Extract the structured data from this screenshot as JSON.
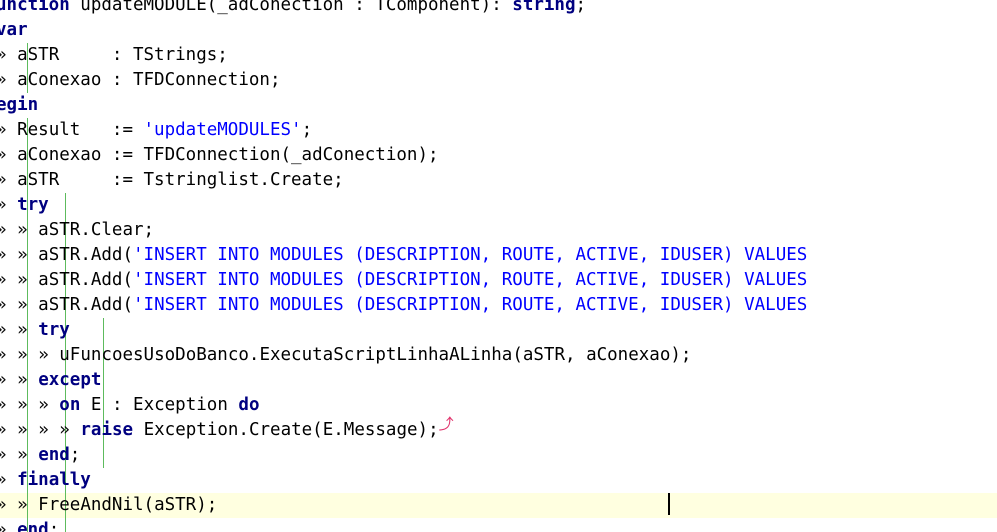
{
  "editor": {
    "lines": [
      {
        "tokens": [
          {
            "k": "k",
            "t": "unction"
          },
          {
            "k": "n",
            "t": " updateMODULE(_adConection : TComponent): "
          },
          {
            "k": "k",
            "t": "string"
          },
          {
            "k": "n",
            "t": ";"
          }
        ]
      },
      {
        "tokens": [
          {
            "k": "k",
            "t": "var"
          }
        ]
      },
      {
        "guides": [
          0
        ],
        "tokens": [
          {
            "k": "g",
            "t": "»"
          },
          {
            "k": "n",
            "t": " aSTR     : TStrings;"
          }
        ]
      },
      {
        "guides": [
          0
        ],
        "tokens": [
          {
            "k": "g",
            "t": "»"
          },
          {
            "k": "n",
            "t": " aConexao : TFDConnection;"
          }
        ]
      },
      {
        "tokens": [
          {
            "k": "k",
            "t": "egin"
          }
        ]
      },
      {
        "guides": [
          0
        ],
        "tokens": [
          {
            "k": "g",
            "t": "»"
          },
          {
            "k": "n",
            "t": " Result   := "
          },
          {
            "k": "s",
            "t": "'updateMODULES'"
          },
          {
            "k": "n",
            "t": ";"
          }
        ]
      },
      {
        "guides": [
          0
        ],
        "tokens": [
          {
            "k": "g",
            "t": "»"
          },
          {
            "k": "n",
            "t": " aConexao := TFDConnection(_adConection);"
          }
        ]
      },
      {
        "guides": [
          0
        ],
        "tokens": [
          {
            "k": "g",
            "t": "»"
          },
          {
            "k": "n",
            "t": " aSTR     := Tstringlist.Create;"
          }
        ]
      },
      {
        "guides": [
          0,
          1
        ],
        "tokens": [
          {
            "k": "g",
            "t": "»"
          },
          {
            "k": "n",
            "t": " "
          },
          {
            "k": "k",
            "t": "try"
          }
        ]
      },
      {
        "guides": [
          0,
          1
        ],
        "tokens": [
          {
            "k": "g",
            "t": "»"
          },
          {
            "k": "n",
            "t": " "
          },
          {
            "k": "g",
            "t": "»"
          },
          {
            "k": "n",
            "t": " aSTR.Clear;"
          }
        ]
      },
      {
        "guides": [
          0,
          1
        ],
        "tokens": [
          {
            "k": "g",
            "t": "»"
          },
          {
            "k": "n",
            "t": " "
          },
          {
            "k": "g",
            "t": "»"
          },
          {
            "k": "n",
            "t": " aSTR.Add("
          },
          {
            "k": "s",
            "t": "'INSERT INTO MODULES (DESCRIPTION, ROUTE, ACTIVE, IDUSER) VALUES"
          }
        ]
      },
      {
        "guides": [
          0,
          1
        ],
        "tokens": [
          {
            "k": "g",
            "t": "»"
          },
          {
            "k": "n",
            "t": " "
          },
          {
            "k": "g",
            "t": "»"
          },
          {
            "k": "n",
            "t": " aSTR.Add("
          },
          {
            "k": "s",
            "t": "'INSERT INTO MODULES (DESCRIPTION, ROUTE, ACTIVE, IDUSER) VALUES"
          }
        ]
      },
      {
        "guides": [
          0,
          1
        ],
        "tokens": [
          {
            "k": "g",
            "t": "»"
          },
          {
            "k": "n",
            "t": " "
          },
          {
            "k": "g",
            "t": "»"
          },
          {
            "k": "n",
            "t": " aSTR.Add("
          },
          {
            "k": "s",
            "t": "'INSERT INTO MODULES (DESCRIPTION, ROUTE, ACTIVE, IDUSER) VALUES"
          }
        ]
      },
      {
        "guides": [
          0,
          1,
          2
        ],
        "tokens": [
          {
            "k": "g",
            "t": "»"
          },
          {
            "k": "n",
            "t": " "
          },
          {
            "k": "g",
            "t": "»"
          },
          {
            "k": "n",
            "t": " "
          },
          {
            "k": "k",
            "t": "try"
          }
        ]
      },
      {
        "guides": [
          0,
          1,
          2
        ],
        "tokens": [
          {
            "k": "g",
            "t": "»"
          },
          {
            "k": "n",
            "t": " "
          },
          {
            "k": "g",
            "t": "»"
          },
          {
            "k": "n",
            "t": " "
          },
          {
            "k": "g",
            "t": "»"
          },
          {
            "k": "n",
            "t": " uFuncoesUsoDoBanco.ExecutaScriptLinhaALinha(aSTR, aConexao);"
          }
        ]
      },
      {
        "guides": [
          0,
          1,
          2
        ],
        "tokens": [
          {
            "k": "g",
            "t": "»"
          },
          {
            "k": "n",
            "t": " "
          },
          {
            "k": "g",
            "t": "»"
          },
          {
            "k": "n",
            "t": " "
          },
          {
            "k": "k",
            "t": "except"
          }
        ]
      },
      {
        "guides": [
          0,
          1,
          2
        ],
        "tokens": [
          {
            "k": "g",
            "t": "»"
          },
          {
            "k": "n",
            "t": " "
          },
          {
            "k": "g",
            "t": "»"
          },
          {
            "k": "n",
            "t": " "
          },
          {
            "k": "g",
            "t": "»"
          },
          {
            "k": "n",
            "t": " "
          },
          {
            "k": "k",
            "t": "on"
          },
          {
            "k": "n",
            "t": " E : Exception "
          },
          {
            "k": "k",
            "t": "do"
          }
        ]
      },
      {
        "guides": [
          0,
          1,
          2
        ],
        "mark": true,
        "tokens": [
          {
            "k": "g",
            "t": "»"
          },
          {
            "k": "n",
            "t": " "
          },
          {
            "k": "g",
            "t": "»"
          },
          {
            "k": "n",
            "t": " "
          },
          {
            "k": "g",
            "t": "»"
          },
          {
            "k": "n",
            "t": " "
          },
          {
            "k": "g",
            "t": "»"
          },
          {
            "k": "n",
            "t": " "
          },
          {
            "k": "k",
            "t": "raise"
          },
          {
            "k": "n",
            "t": " Exception.Create(E.Message);"
          }
        ]
      },
      {
        "guides": [
          0,
          1,
          2
        ],
        "tokens": [
          {
            "k": "g",
            "t": "»"
          },
          {
            "k": "n",
            "t": " "
          },
          {
            "k": "g",
            "t": "»"
          },
          {
            "k": "n",
            "t": " "
          },
          {
            "k": "k",
            "t": "end"
          },
          {
            "k": "n",
            "t": ";"
          }
        ]
      },
      {
        "guides": [
          0,
          1
        ],
        "tokens": [
          {
            "k": "g",
            "t": "»"
          },
          {
            "k": "n",
            "t": " "
          },
          {
            "k": "k",
            "t": "finally"
          }
        ]
      },
      {
        "guides": [
          0,
          1
        ],
        "current": true,
        "tokens": [
          {
            "k": "g",
            "t": "»"
          },
          {
            "k": "n",
            "t": " "
          },
          {
            "k": "g",
            "t": "»"
          },
          {
            "k": "n",
            "t": " FreeAndNil(aSTR);"
          }
        ]
      },
      {
        "guides": [
          0,
          1
        ],
        "tokens": [
          {
            "k": "g",
            "t": "»"
          },
          {
            "k": "n",
            "t": " "
          },
          {
            "k": "k",
            "t": "end"
          },
          {
            "k": "n",
            "t": ";"
          }
        ]
      }
    ],
    "mark_glyph": "⤴",
    "colors": {
      "keyword": "#000080",
      "string": "#0000ff",
      "text": "#000000",
      "guide": "#5dbb5d",
      "current_line": "#ffffe0"
    }
  }
}
